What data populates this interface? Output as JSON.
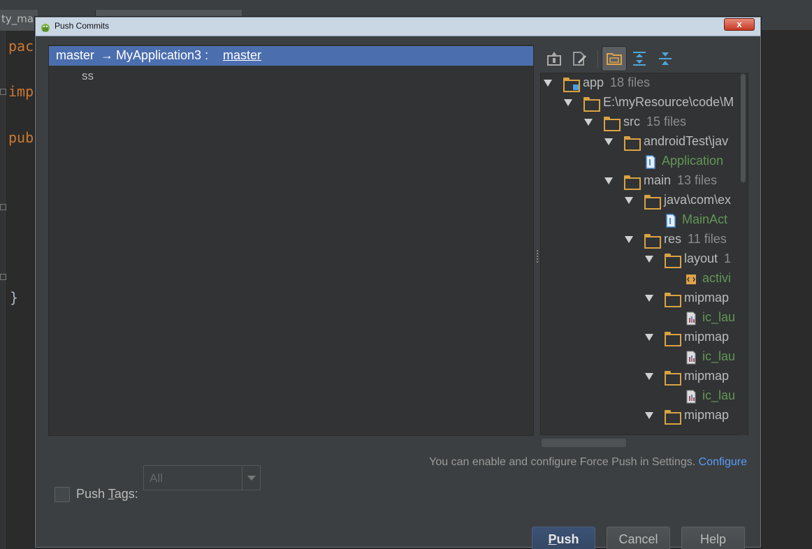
{
  "ide": {
    "tab_label": "ty_ma",
    "code_lines": [
      "pac",
      "imp",
      "pub",
      "}"
    ]
  },
  "dialog": {
    "title": "Push Commits",
    "close_label": "x"
  },
  "commit_list": {
    "source_branch": "master",
    "arrow": "→",
    "target_repo": "MyApplication3 :",
    "target_branch": "master",
    "commits": [
      "ss"
    ]
  },
  "tree": {
    "rows": [
      {
        "label": "app",
        "count": "18 files",
        "kind": "module"
      },
      {
        "label": "E:\\myResource\\code\\M",
        "count": "",
        "kind": "folder"
      },
      {
        "label": "src",
        "count": "15 files",
        "kind": "folder"
      },
      {
        "label": "androidTest\\jav",
        "count": "",
        "kind": "folder"
      },
      {
        "label": "Application",
        "count": "",
        "kind": "java-file"
      },
      {
        "label": "main",
        "count": "13 files",
        "kind": "folder"
      },
      {
        "label": "java\\com\\ex",
        "count": "",
        "kind": "folder"
      },
      {
        "label": "MainAct",
        "count": "",
        "kind": "java-file"
      },
      {
        "label": "res",
        "count": "11 files",
        "kind": "folder"
      },
      {
        "label": "layout",
        "count": "1",
        "kind": "folder"
      },
      {
        "label": "activi",
        "count": "",
        "kind": "xml-file"
      },
      {
        "label": "mipmap",
        "count": "",
        "kind": "folder"
      },
      {
        "label": "ic_lau",
        "count": "",
        "kind": "image-file"
      },
      {
        "label": "mipmap",
        "count": "",
        "kind": "folder"
      },
      {
        "label": "ic_lau",
        "count": "",
        "kind": "image-file"
      },
      {
        "label": "mipmap",
        "count": "",
        "kind": "folder"
      },
      {
        "label": "ic_lau",
        "count": "",
        "kind": "image-file"
      },
      {
        "label": "mipmap",
        "count": "",
        "kind": "folder"
      }
    ]
  },
  "toolbar": {
    "icons": [
      "show-diff-icon",
      "edit-source-icon",
      "group-by-directory-icon",
      "expand-all-icon",
      "collapse-all-icon"
    ]
  },
  "force_push": {
    "text": "You can enable and configure Force Push in Settings.",
    "link": "Configure"
  },
  "push_tags": {
    "label_before": "Push ",
    "label_mnemonic": "T",
    "label_after": "ags:",
    "checked": false,
    "select_value": "All"
  },
  "buttons": {
    "push_mnemonic": "P",
    "push_rest": "ush",
    "cancel": "Cancel",
    "help": "Help"
  },
  "colors": {
    "selection": "#4b6eaf",
    "green_file": "#629755",
    "folder": "#d9a343",
    "link": "#589df6"
  }
}
